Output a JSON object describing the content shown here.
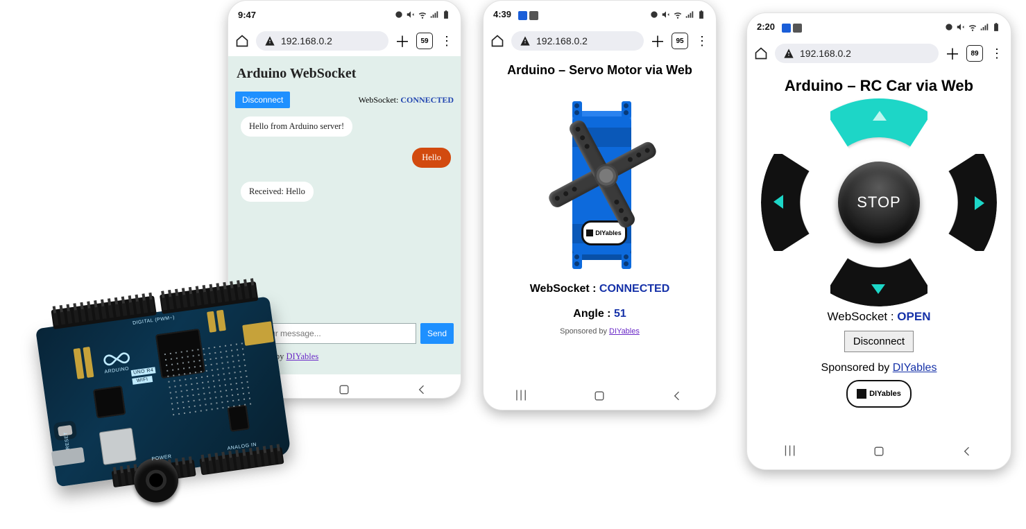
{
  "phone1": {
    "time": "9:47",
    "url": "192.168.0.2",
    "tabs": "59",
    "title": "Arduino WebSocket",
    "disconnect": "Disconnect",
    "ws_label": "WebSocket:",
    "ws_state": "CONNECTED",
    "msg1": "Hello from Arduino server!",
    "msg2": "Hello",
    "msg3": "Received: Hello",
    "placeholder": "Type your message...",
    "send": "Send",
    "spons_prefix": "Sponsored by ",
    "spons_link": "DIYables"
  },
  "phone2": {
    "time": "4:39",
    "url": "192.168.0.2",
    "tabs": "95",
    "title": "Arduino – Servo Motor via Web",
    "ws_label": "WebSocket : ",
    "ws_state": "CONNECTED",
    "angle_label": "Angle : ",
    "angle_value": "51",
    "spons_prefix": "Sponsored by ",
    "spons_link": "DIYables",
    "logo_text": "DIYables"
  },
  "phone3": {
    "time": "2:20",
    "url": "192.168.0.2",
    "tabs": "89",
    "title": "Arduino – RC Car via Web",
    "stop": "STOP",
    "ws_label": "WebSocket : ",
    "ws_state": "OPEN",
    "disconnect": "Disconnect",
    "spons_prefix": "Sponsored by ",
    "spons_link": "DIYables",
    "logo_text": "DIYables"
  },
  "board": {
    "name": "ARDUINO",
    "model": "UNO R4",
    "variant": "WIFI",
    "reset": "RESET",
    "digital": "DIGITAL (PWM~)",
    "analog": "ANALOG IN",
    "power": "POWER"
  }
}
